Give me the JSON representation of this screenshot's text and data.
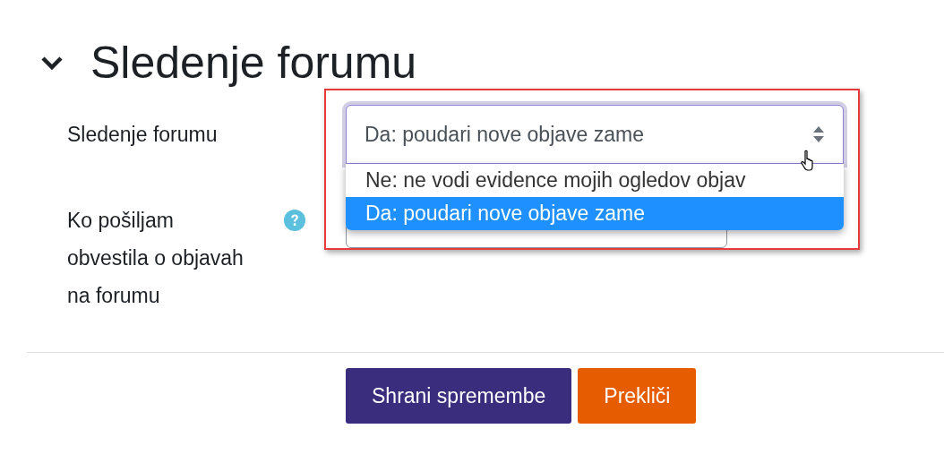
{
  "section": {
    "title": "Sledenje forumu",
    "expanded": true
  },
  "fields": [
    {
      "kind": "select",
      "label": "Sledenje forumu",
      "value": "Da: poudari nove objave zame",
      "open": true,
      "highlighted": true,
      "options": [
        {
          "label": "Ne: ne vodi evidence mojih ogledov objav",
          "selected": false
        },
        {
          "label": "Da: poudari nove objave zame",
          "selected": true
        }
      ]
    },
    {
      "kind": "select",
      "label": "Ko pošiljam obvestila o objavah na forumu",
      "help": true
    }
  ],
  "buttons": [
    {
      "label": "Shrani spremembe",
      "kind": "primary"
    },
    {
      "label": "Prekliči",
      "kind": "cancel"
    }
  ]
}
